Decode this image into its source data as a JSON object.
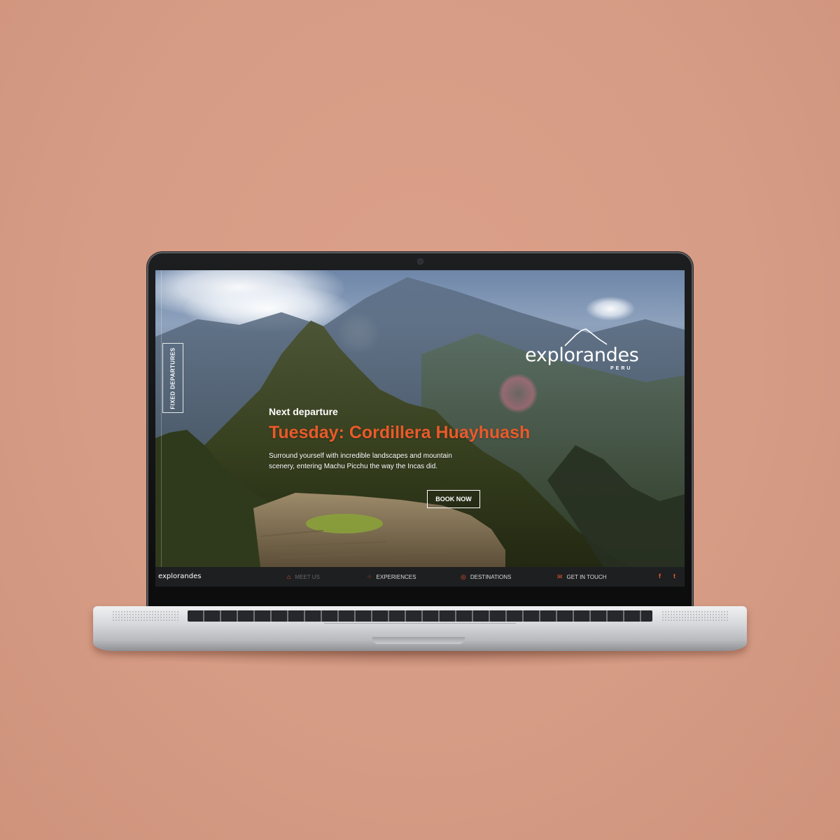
{
  "colors": {
    "background": "#d69c85",
    "accent": "#ea5a2a",
    "navbar": "#1e1f21"
  },
  "site": {
    "brand": "explorandes",
    "brand_sub": "PERU"
  },
  "side_tab": {
    "label": "FIXED DEPARTURES"
  },
  "hero": {
    "eyebrow": "Next departure",
    "title": "Tuesday: Cordillera Huayhuash",
    "description": "Surround yourself with incredible landscapes and mountain scenery, entering Machu Picchu the way the Incas did.",
    "cta": "BOOK NOW"
  },
  "nav": {
    "logo": "explorandes",
    "items": [
      {
        "label": "MEET US",
        "icon": "home-icon"
      },
      {
        "label": "EXPERIENCES",
        "icon": "grid-icon"
      },
      {
        "label": "DESTINATIONS",
        "icon": "compass-icon"
      },
      {
        "label": "GET IN TOUCH",
        "icon": "mail-icon"
      }
    ],
    "social": [
      {
        "label": "f",
        "icon": "facebook-icon"
      },
      {
        "label": "t",
        "icon": "twitter-icon"
      }
    ]
  }
}
